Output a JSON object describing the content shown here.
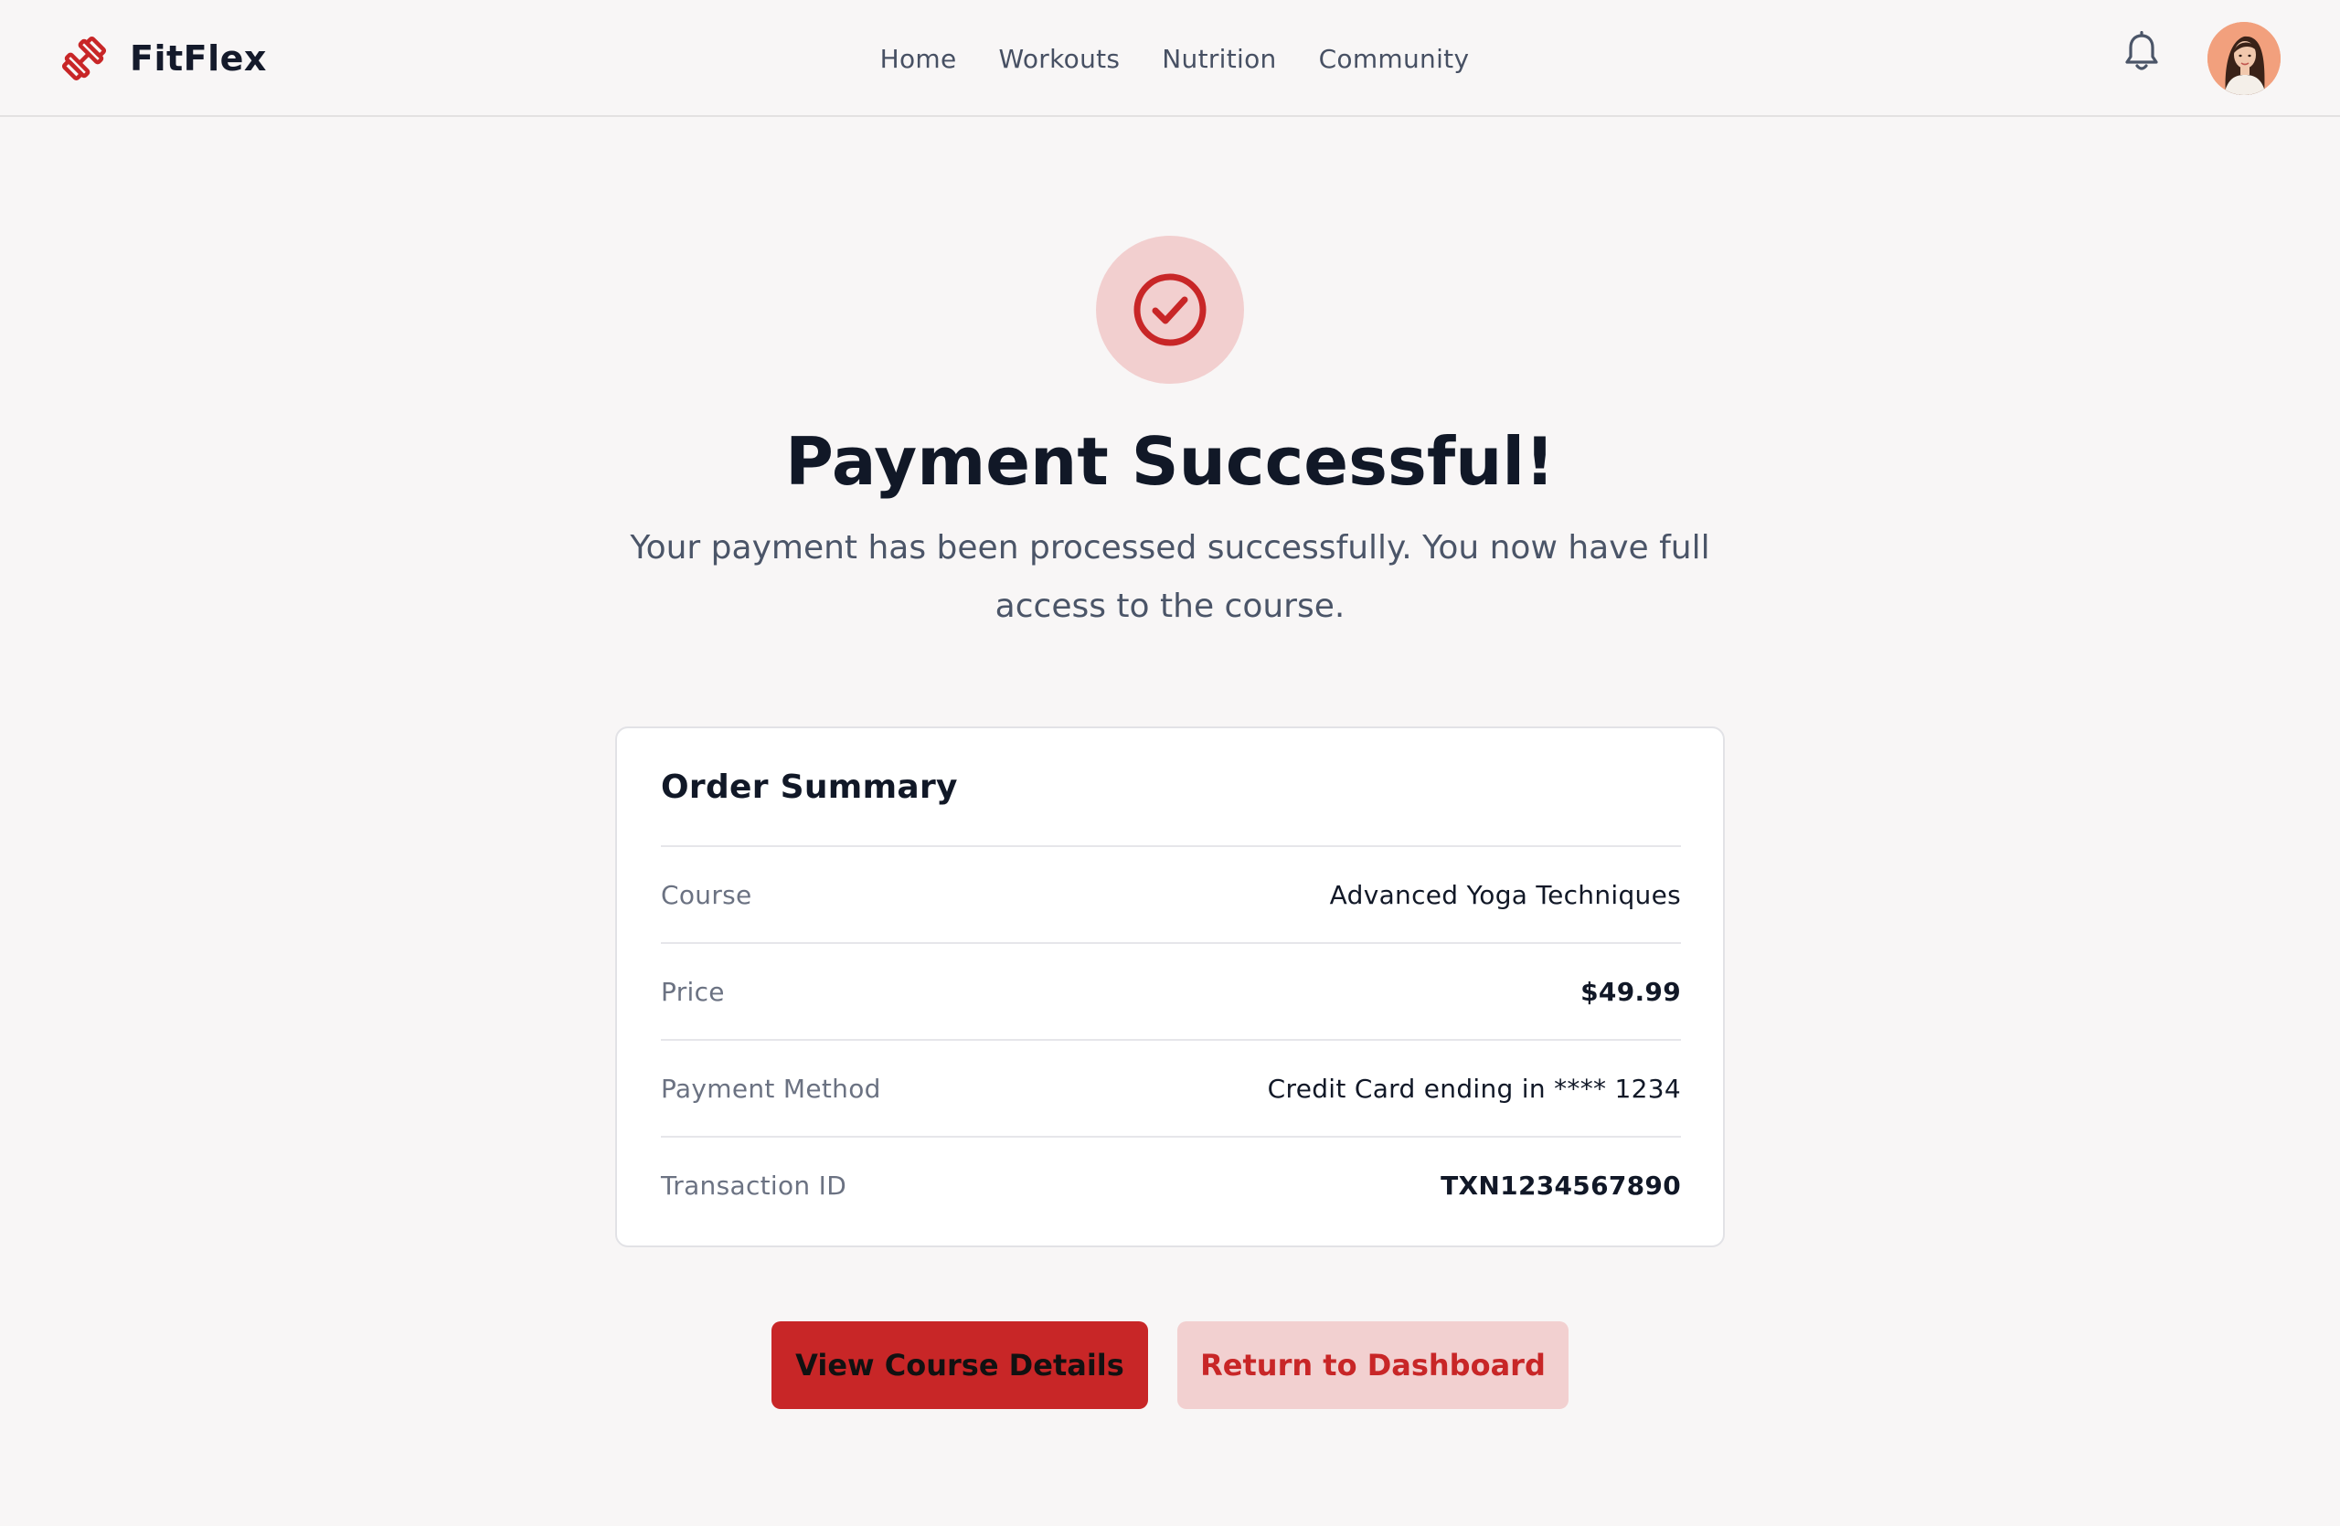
{
  "header": {
    "brand_name": "FitFlex",
    "logo_icon": "dumbbell-icon",
    "nav": [
      {
        "label": "Home"
      },
      {
        "label": "Workouts"
      },
      {
        "label": "Nutrition"
      },
      {
        "label": "Community"
      }
    ],
    "notification_icon": "bell-icon",
    "avatar_icon": "user-avatar"
  },
  "success": {
    "icon": "check-circle-icon",
    "title": "Payment Successful!",
    "message": "Your payment has been processed successfully. You now have full access to the course."
  },
  "order_summary": {
    "title": "Order Summary",
    "rows": [
      {
        "label": "Course",
        "value": "Advanced Yoga Techniques"
      },
      {
        "label": "Price",
        "value": "$49.99"
      },
      {
        "label": "Payment Method",
        "value": "Credit Card ending in **** 1234"
      },
      {
        "label": "Transaction ID",
        "value": "TXN1234567890"
      }
    ]
  },
  "actions": {
    "primary_label": "View Course Details",
    "secondary_label": "Return to Dashboard"
  },
  "colors": {
    "accent": "#c82627",
    "accent_light": "#f2cfcf",
    "background": "#f8f6f6",
    "card": "#ffffff",
    "text_dark": "#111827",
    "text_muted": "#6b7282"
  }
}
